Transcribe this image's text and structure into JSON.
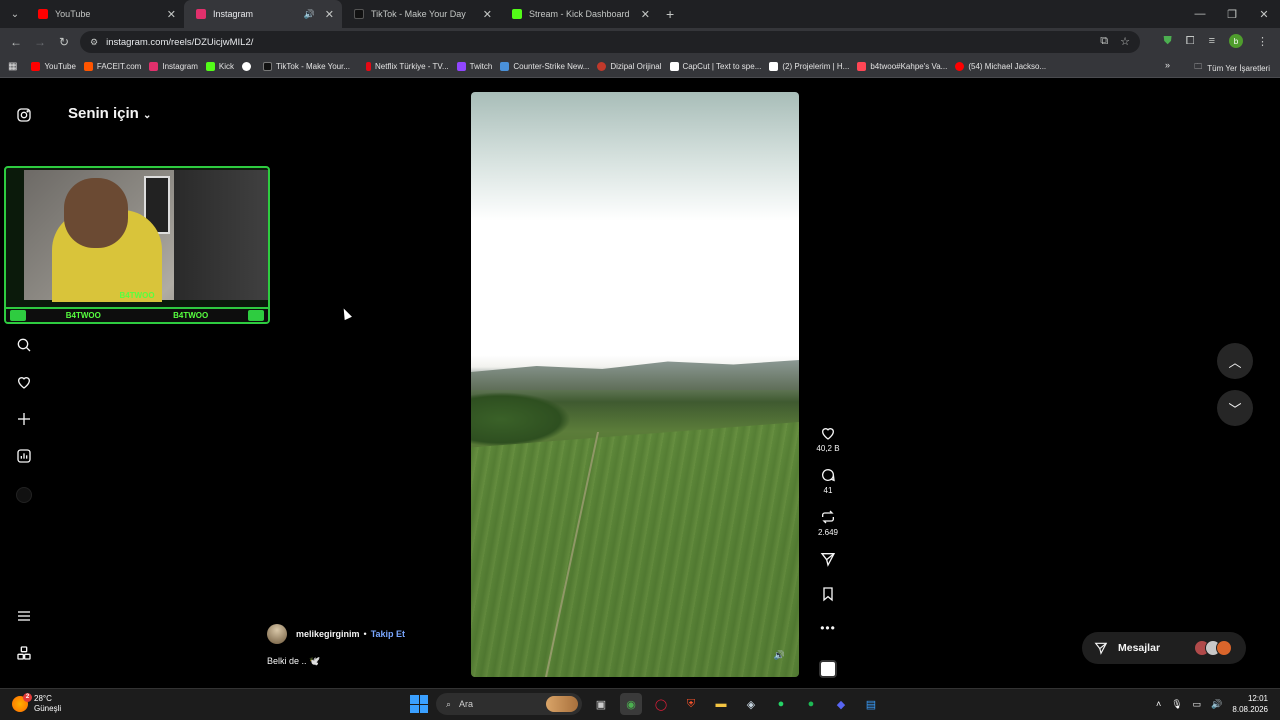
{
  "browser": {
    "tabs": [
      {
        "title": "YouTube",
        "color": "#ff0000",
        "active": false
      },
      {
        "title": "Instagram",
        "color": "#e1306c",
        "active": true
      },
      {
        "title": "TikTok - Make Your Day",
        "color": "#111111",
        "active": false
      },
      {
        "title": "Stream - Kick Dashboard",
        "color": "#53fc18",
        "active": false
      }
    ],
    "url": "instagram.com/reels/DZUicjwMIL2/",
    "profile_initial": "b",
    "bookmarks": [
      {
        "label": "YouTube",
        "color": "#ff0000"
      },
      {
        "label": "FACEIT.com",
        "color": "#ff5500"
      },
      {
        "label": "Instagram",
        "color": "#e1306c"
      },
      {
        "label": "Kick",
        "color": "#53fc18"
      },
      {
        "label": "",
        "color": "#ffffff"
      },
      {
        "label": "TikTok - Make Your...",
        "color": "#111111"
      },
      {
        "label": "Netflix Türkiye - TV...",
        "color": "#e50914"
      },
      {
        "label": "Twitch",
        "color": "#9146ff"
      },
      {
        "label": "Counter-Strike New...",
        "color": "#4a90d9"
      },
      {
        "label": "Dizipal Orijinal",
        "color": "#c0392b"
      },
      {
        "label": "CapCut | Text to spe...",
        "color": "#ffffff"
      },
      {
        "label": "(2) Projelerim | H...",
        "color": "#ffffff"
      },
      {
        "label": "b4twoo#Kahpe's Va...",
        "color": "#ff4655"
      },
      {
        "label": "(54) Michael Jackso...",
        "color": "#ff0000"
      }
    ],
    "all_bookmarks": "Tüm Yer İşaretleri"
  },
  "instagram": {
    "feed_title": "Senin için",
    "author": "melikegirginim",
    "separator": "•",
    "follow": "Takip Et",
    "caption": "Belki de .. 🕊️",
    "likes": "40,2 B",
    "comments": "41",
    "reposts": "2.649",
    "messages_label": "Mesajlar"
  },
  "overlay": {
    "cam_label": "B4TWOO",
    "bar_left": "B4TWOO",
    "bar_right": "B4TWOO"
  },
  "taskbar": {
    "temperature": "28°C",
    "weather": "Güneşli",
    "weather_badge": "2",
    "search_placeholder": "Ara",
    "time": "12:01",
    "date": "8.08.2026"
  }
}
